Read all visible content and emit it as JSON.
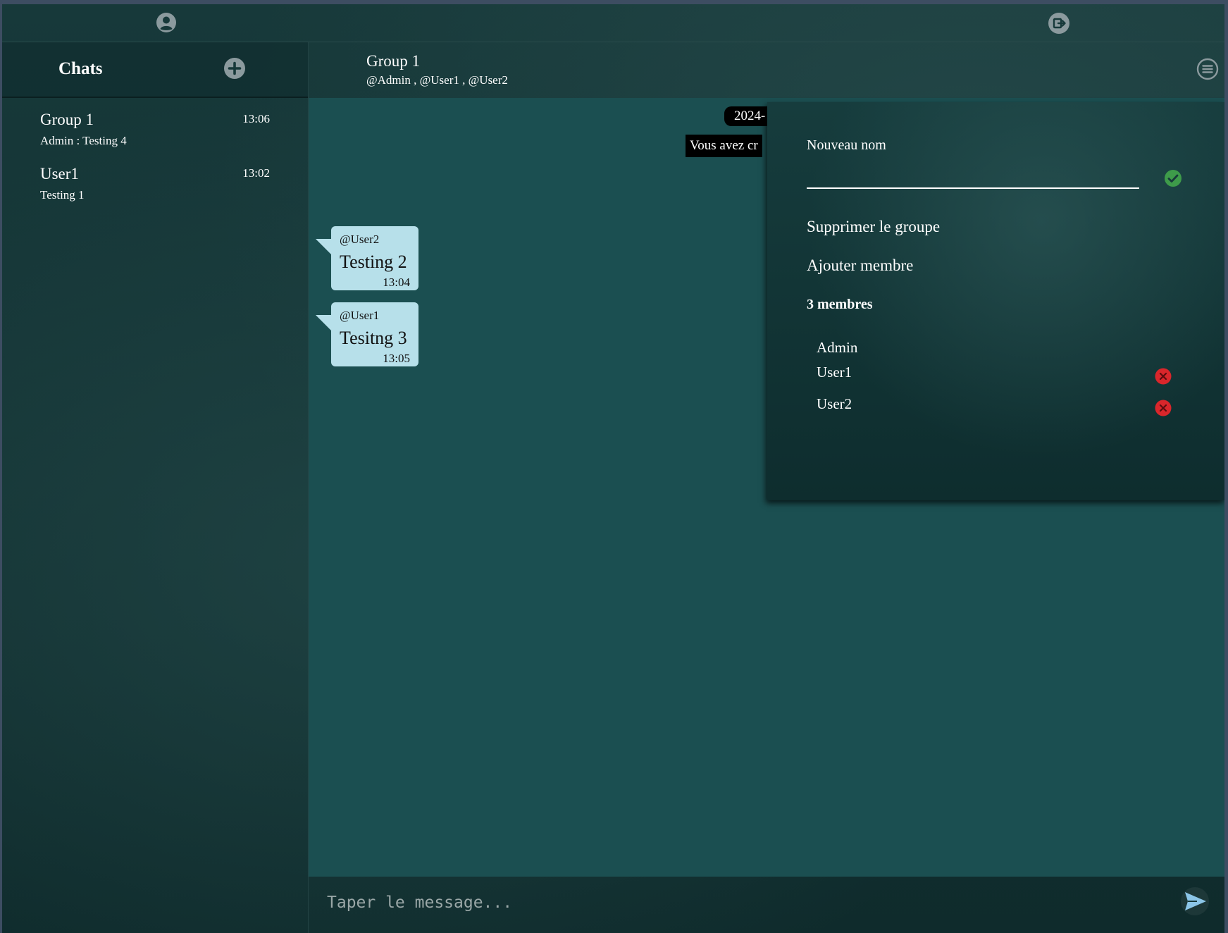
{
  "sidebar": {
    "title": "Chats",
    "chats": [
      {
        "name": "Group 1",
        "preview": "Admin : Testing 4",
        "time": "13:06"
      },
      {
        "name": "User1",
        "preview": "Testing 1",
        "time": "13:02"
      }
    ]
  },
  "header": {
    "group_name": "Group 1",
    "members": "@Admin , @User1 , @User2"
  },
  "messages": {
    "date": "2024-",
    "system": "Vous avez cr",
    "items": [
      {
        "author": "@User2",
        "text": "Testing 2",
        "time": "13:04"
      },
      {
        "author": "@User1",
        "text": "Tesitng 3",
        "time": "13:05"
      }
    ]
  },
  "composer": {
    "placeholder": "Taper le message..."
  },
  "panel": {
    "rename_label": "Nouveau nom",
    "rename_value": "",
    "delete_group": "Supprimer le groupe",
    "add_member": "Ajouter membre",
    "members_count": "3 membres",
    "members": [
      "Admin",
      "User1",
      "User2"
    ]
  },
  "icons": {
    "profile": "user-circle-icon",
    "logout": "logout-icon",
    "new_chat": "plus-circle-icon",
    "menu": "menu-icon",
    "confirm": "check-circle-icon",
    "remove": "x-circle-icon",
    "send": "send-icon"
  },
  "colors": {
    "chat_area": "#1b4f51",
    "bubble": "#b7e0ea",
    "confirm_green": "#3e9b4a",
    "remove_red": "#d9262b"
  }
}
